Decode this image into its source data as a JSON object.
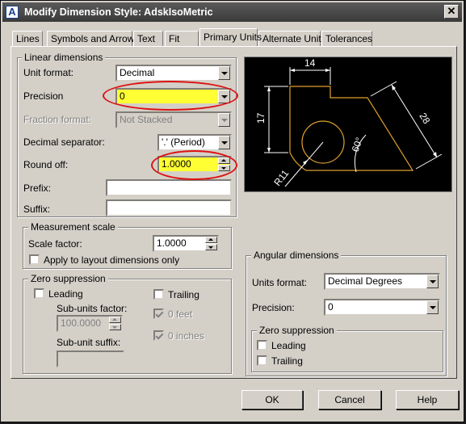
{
  "window": {
    "title": "Modify Dimension Style: AdskIsoMetric",
    "icon_letter": "A",
    "close_glyph": "✕"
  },
  "tabs": [
    {
      "label": "Lines"
    },
    {
      "label": "Symbols and Arrows"
    },
    {
      "label": "Text"
    },
    {
      "label": "Fit"
    },
    {
      "label": "Primary Units",
      "active": true
    },
    {
      "label": "Alternate Units"
    },
    {
      "label": "Tolerances"
    }
  ],
  "linear": {
    "legend": "Linear dimensions",
    "unit_format": {
      "label": "Unit format:",
      "value": "Decimal"
    },
    "precision": {
      "label": "Precision",
      "value": "0"
    },
    "fraction_format": {
      "label": "Fraction format:",
      "value": "Not Stacked"
    },
    "decimal_separator": {
      "label": "Decimal separator:",
      "value": "'.' (Period)"
    },
    "round_off": {
      "label": "Round off:",
      "value": "1.0000"
    },
    "prefix": {
      "label": "Prefix:",
      "value": ""
    },
    "suffix": {
      "label": "Suffix:",
      "value": ""
    }
  },
  "measurement_scale": {
    "legend": "Measurement scale",
    "scale_factor": {
      "label": "Scale factor:",
      "value": "1.0000"
    },
    "apply_layout": {
      "label": "Apply to layout dimensions only",
      "checked": false
    }
  },
  "zero_suppression": {
    "legend": "Zero suppression",
    "leading": "Leading",
    "trailing": "Trailing",
    "sub_units_factor": {
      "label": "Sub-units factor:",
      "value": "100.0000"
    },
    "zero_feet": "0 feet",
    "zero_inches": "0 inches",
    "sub_unit_suffix": {
      "label": "Sub-unit suffix:",
      "value": ""
    }
  },
  "preview": {
    "dim_top": "14",
    "dim_left": "17",
    "dim_slant": "28",
    "dim_angle": "60°",
    "dim_radius": "R11"
  },
  "angular": {
    "legend": "Angular dimensions",
    "units_format": {
      "label": "Units format:",
      "value": "Decimal Degrees"
    },
    "precision": {
      "label": "Precision:",
      "value": "0"
    },
    "zero_legend": "Zero suppression",
    "leading": "Leading",
    "trailing": "Trailing"
  },
  "buttons": {
    "ok": "OK",
    "cancel": "Cancel",
    "help": "Help"
  },
  "colors": {
    "highlight": "#ffff33",
    "annotation": "#dd1111",
    "drawing": "#e0a030",
    "dims": "#ffffff"
  }
}
